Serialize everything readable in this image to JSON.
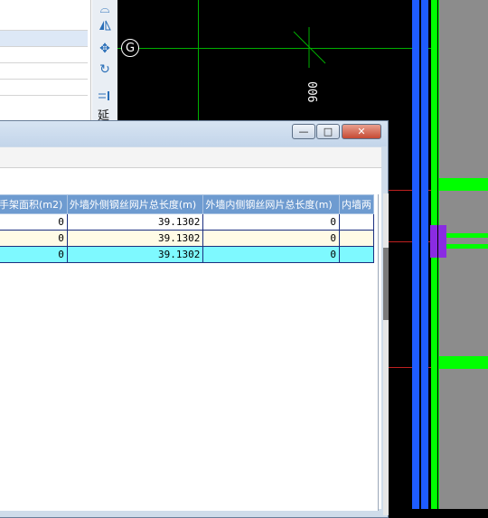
{
  "toolbar": {
    "icons": [
      "mirror-icon",
      "mirror-vertical-icon",
      "move-icon",
      "rotate-icon",
      "extend-icon"
    ],
    "extend_label": "延"
  },
  "cad": {
    "axis_label": "G",
    "dimension_text": "006",
    "colors": {
      "blue_wall": "#1e5cff",
      "green_wall": "#00ff00",
      "purple_marker": "#8a2be2",
      "fill_gray": "#8c8c8c",
      "grid_green": "#00c000",
      "axis_red": "#d02020"
    }
  },
  "dialog": {
    "buttons": {
      "minimize": "—",
      "maximize": "□",
      "close": "✕"
    },
    "table": {
      "columns": [
        "手架面积(m2)",
        "外墙外侧钢丝网片总长度(m)",
        "外墙内侧钢丝网片总长度(m)",
        "内墙两"
      ],
      "rows": [
        [
          "0",
          "39.1302",
          "0",
          ""
        ],
        [
          "0",
          "39.1302",
          "0",
          ""
        ],
        [
          "0",
          "39.1302",
          "0",
          ""
        ]
      ]
    }
  }
}
